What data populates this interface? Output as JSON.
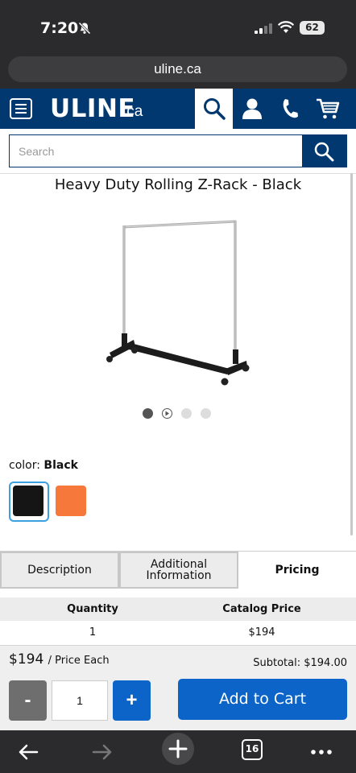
{
  "status_bar": {
    "time": "7:20",
    "battery": "62",
    "icons": [
      "bell-slash-icon",
      "signal-icon",
      "wifi-icon",
      "battery-icon"
    ]
  },
  "browser": {
    "url": "uline.ca",
    "toolbar": {
      "tab_count": "16",
      "icons": [
        "back-arrow-icon",
        "forward-arrow-icon",
        "new-tab-plus-icon",
        "tabs-icon",
        "more-icon"
      ]
    }
  },
  "header": {
    "logo": "ULINE",
    "logo_suffix": ".ca",
    "icons": [
      "menu-icon",
      "search-icon",
      "account-icon",
      "phone-icon",
      "cart-icon"
    ]
  },
  "search": {
    "placeholder": "Search"
  },
  "product": {
    "title": "Heavy Duty Rolling Z-Rack - Black",
    "carousel_count": 4,
    "carousel_active": 1,
    "color_label": "color:",
    "color_value": "Black",
    "swatches": [
      {
        "name": "Black",
        "hex": "#151515",
        "selected": true
      },
      {
        "name": "Orange",
        "hex": "#f6783a",
        "selected": false
      }
    ]
  },
  "tabs": [
    {
      "label": "Description",
      "active": false
    },
    {
      "label": "Additional Information",
      "active": false
    },
    {
      "label": "Pricing",
      "active": true
    }
  ],
  "pricing_table": {
    "headers": [
      "Quantity",
      "Catalog Price"
    ],
    "rows": [
      [
        "1",
        "$194"
      ]
    ]
  },
  "cart_bar": {
    "price": "$194",
    "price_suffix": "/ Price Each",
    "subtotal_label": "Subtotal:",
    "subtotal_value": "$194.00",
    "minus_label": "-",
    "plus_label": "+",
    "quantity": "1",
    "add_to_cart": "Add to Cart"
  },
  "colors": {
    "uline_navy": "#00386f",
    "add_to_cart_blue": "#0c64c8",
    "minus_gray": "#6e6e6e",
    "swatch_selected_border": "#3aa0e0"
  }
}
